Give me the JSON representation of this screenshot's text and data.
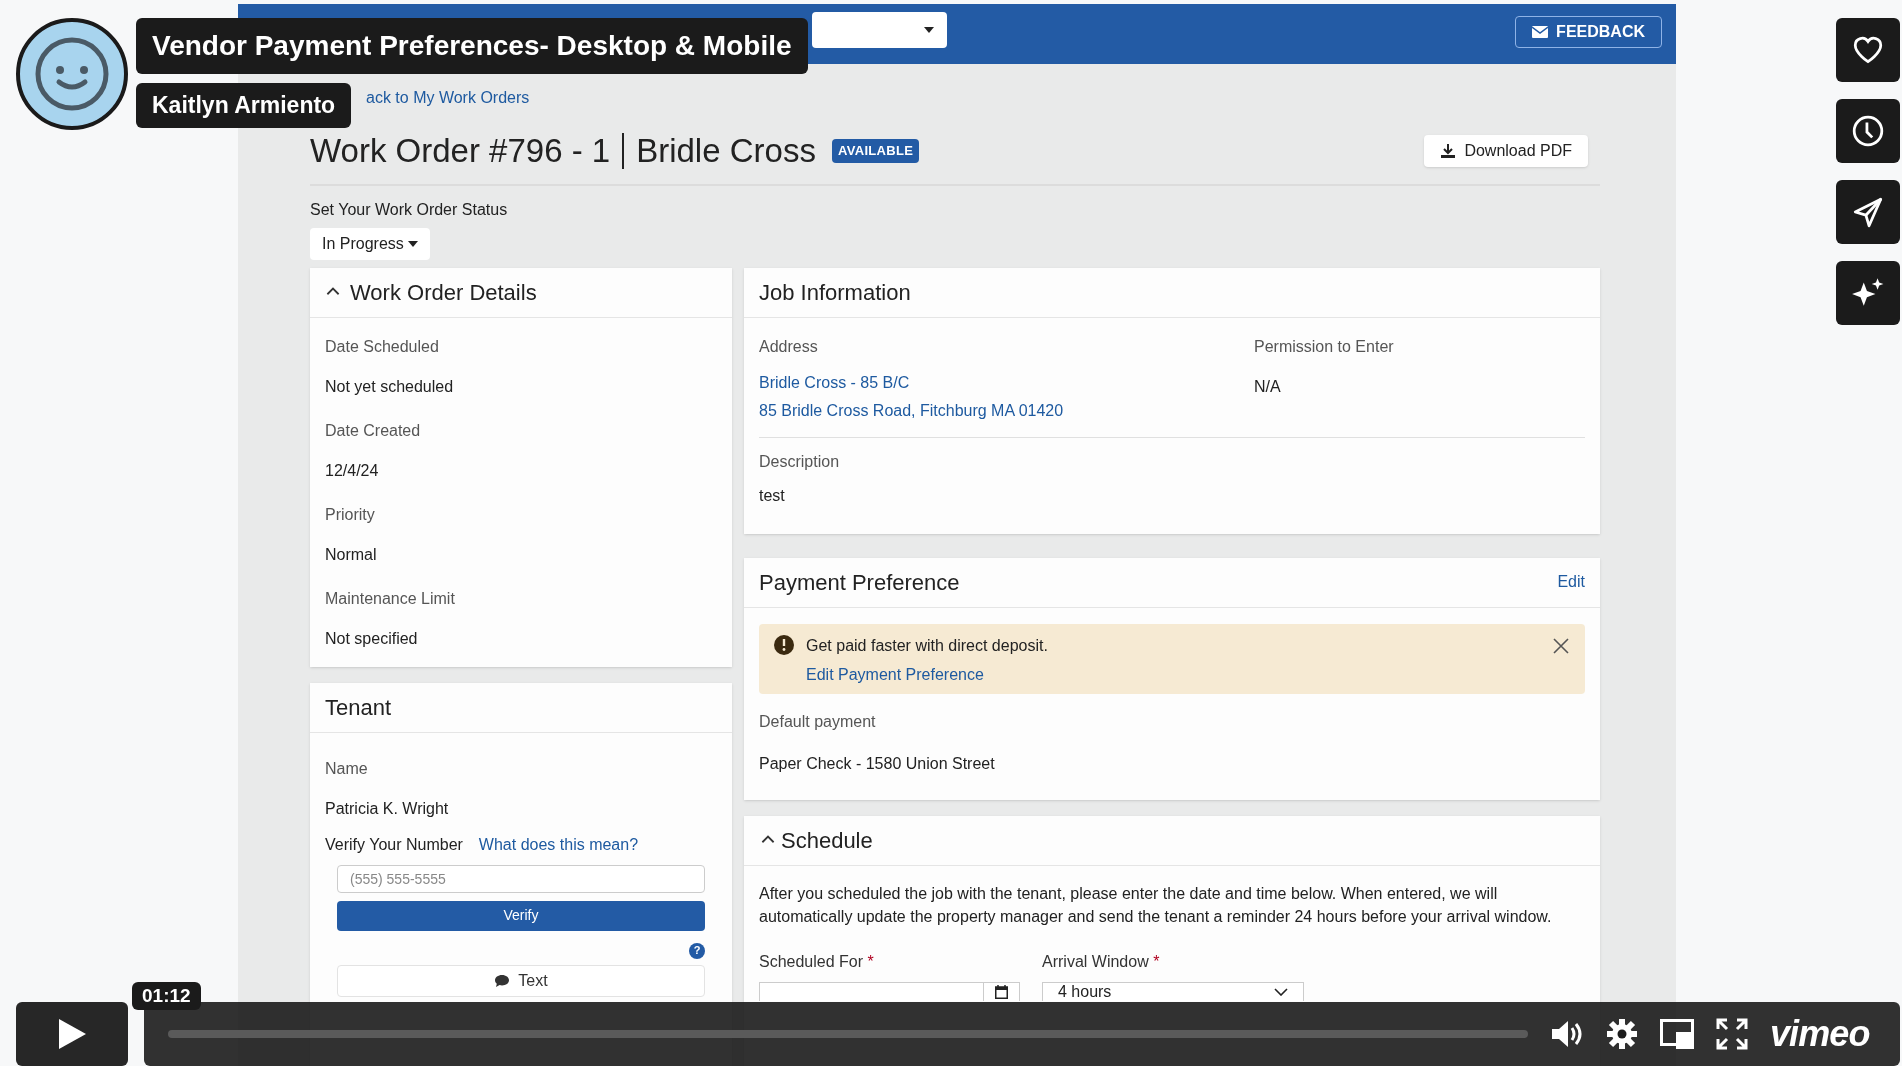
{
  "video": {
    "title": "Vendor Payment Preferences- Desktop & Mobile",
    "author": "Kaitlyn Armiento",
    "time": "01:12",
    "brand": "vimeo"
  },
  "app": {
    "header": {
      "feedback": "FEEDBACK"
    },
    "back_link": "ack to My Work Orders",
    "title": "Work Order #796 - 1",
    "subtitle": "Bridle Cross",
    "badge": "AVAILABLE",
    "download": "Download PDF",
    "status_label": "Set Your Work Order Status",
    "status_value": "In Progress",
    "details": {
      "title": "Work Order Details",
      "expanded": true,
      "fields": [
        {
          "label": "Date Scheduled",
          "value": "Not yet scheduled"
        },
        {
          "label": "Date Created",
          "value": "12/4/24"
        },
        {
          "label": "Priority",
          "value": "Normal"
        },
        {
          "label": "Maintenance Limit",
          "value": "Not specified"
        }
      ]
    },
    "tenant": {
      "title": "Tenant",
      "name_label": "Name",
      "name": "Patricia K. Wright",
      "verify_label": "Verify Your Number",
      "verify_help": "What does this mean?",
      "phone_placeholder": "(555) 555-5555",
      "verify_button": "Verify",
      "help_icon": "?",
      "text_button": "Text"
    },
    "job": {
      "title": "Job Information",
      "address_label": "Address",
      "address_lines": [
        "Bridle Cross - 85 B/C",
        "85 Bridle Cross Road, Fitchburg MA 01420"
      ],
      "permission_label": "Permission to Enter",
      "permission": "N/A",
      "description_label": "Description",
      "description": "test"
    },
    "payment": {
      "title": "Payment Preference",
      "edit": "Edit",
      "alert": "Get paid faster with direct deposit.",
      "alert_link": "Edit Payment Preference",
      "default_label": "Default payment",
      "default_value": "Paper Check - 1580 Union Street"
    },
    "schedule": {
      "title": "Schedule",
      "expanded": true,
      "text": "After you scheduled the job with the tenant, please enter the date and time below. When entered, we will automatically update the property manager and send the tenant a reminder 24 hours before your arrival window.",
      "scheduled_label": "Scheduled For",
      "scheduled_required": "*",
      "arrival_label": "Arrival Window",
      "arrival_required": "*",
      "arrival_value": "4 hours"
    }
  }
}
